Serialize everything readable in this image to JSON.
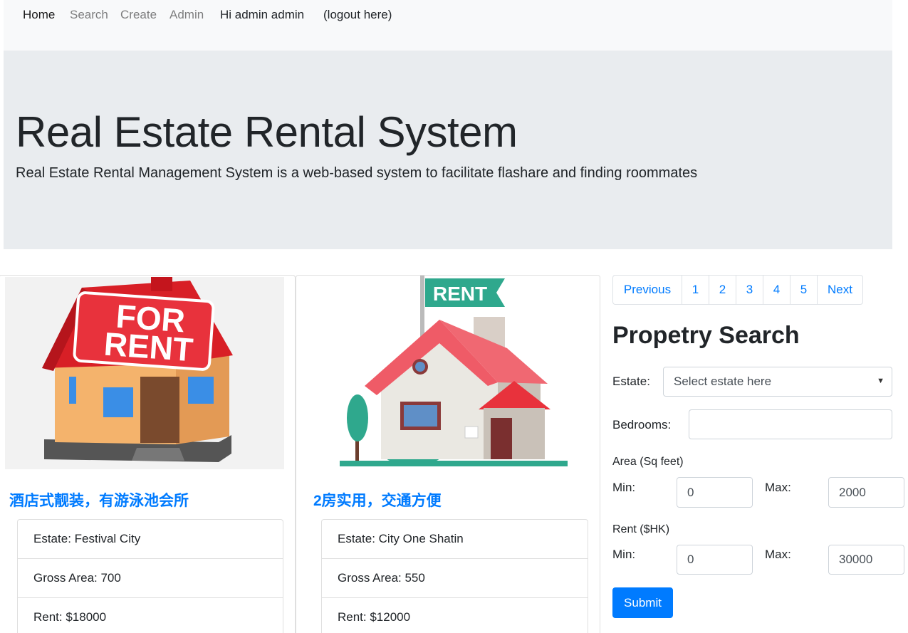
{
  "navbar": {
    "items": [
      "Home",
      "Search",
      "Create",
      "Admin"
    ],
    "greeting": "Hi admin admin",
    "logout": "(logout here)"
  },
  "jumbotron": {
    "title": "Real Estate Rental System",
    "lead": "Real Estate Rental Management System is a web-based system to facilitate flashare and finding roommates"
  },
  "listings": [
    {
      "image_text": "FOR RENT",
      "title": "酒店式靓装，有游泳池会所",
      "estate": "Estate: Festival City",
      "gross_area": "Gross Area: 700",
      "rent": "Rent: $18000"
    },
    {
      "image_text": "RENT",
      "title": "2房实用，交通方便",
      "estate": "Estate: City One Shatin",
      "gross_area": "Gross Area: 550",
      "rent": "Rent: $12000"
    }
  ],
  "pagination": [
    "Previous",
    "1",
    "2",
    "3",
    "4",
    "5",
    "Next"
  ],
  "search": {
    "title": "Propetry Search",
    "estate_label": "Estate:",
    "estate_placeholder": "Select estate here",
    "bedrooms_label": "Bedrooms:",
    "bedrooms_value": "",
    "area_label": "Area (Sq feet)",
    "area_min_label": "Min:",
    "area_min": "0",
    "area_max_label": "Max:",
    "area_max": "2000",
    "rent_label": "Rent ($HK)",
    "rent_min_label": "Min:",
    "rent_min": "0",
    "rent_max_label": "Max:",
    "rent_max": "30000",
    "submit": "Submit"
  },
  "colors": {
    "primary": "#007bff",
    "navbar_bg": "#f8f9fa",
    "jumbotron_bg": "#e9ecef",
    "roof_red": "#e8323c",
    "rent_green": "#2fa88d"
  }
}
